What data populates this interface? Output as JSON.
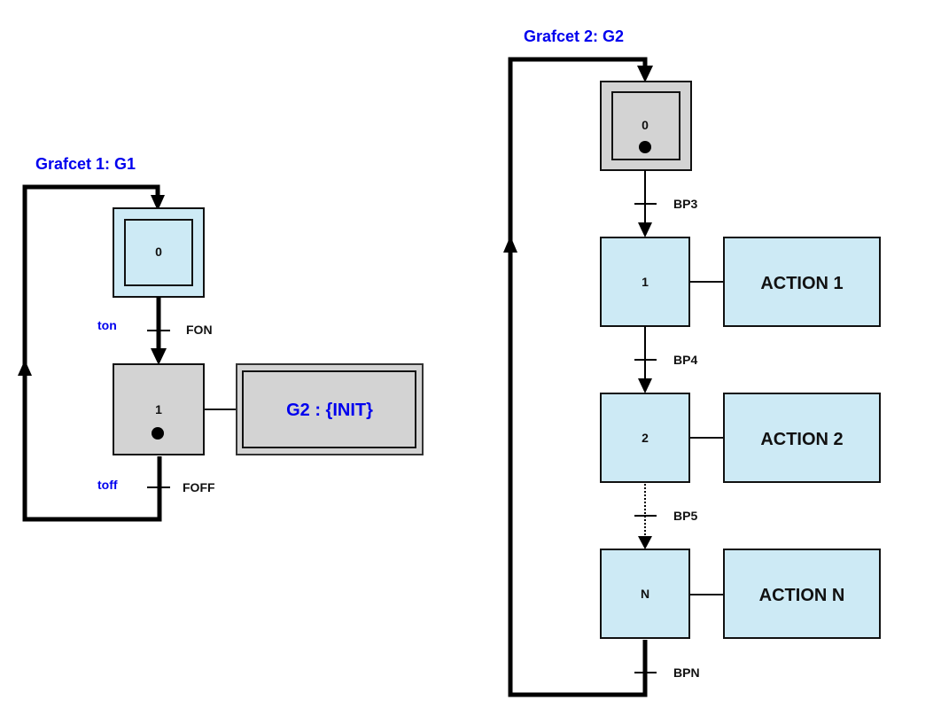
{
  "colors": {
    "active_step": "#d3d3d3",
    "inactive_step": "#cdeaf5",
    "title": "#0000ee",
    "line": "#000000"
  },
  "grafcet1": {
    "title": "Grafcet 1: G1",
    "steps": [
      {
        "id": "0",
        "initial": true,
        "active": false
      },
      {
        "id": "1",
        "initial": false,
        "active": true
      }
    ],
    "transitions": [
      {
        "label": "FON",
        "variable": "ton"
      },
      {
        "label": "FOFF",
        "variable": "toff"
      }
    ],
    "actions": [
      {
        "step": "1",
        "label": "G2 : {INIT}",
        "type": "macro"
      }
    ]
  },
  "grafcet2": {
    "title": "Grafcet 2: G2",
    "steps": [
      {
        "id": "0",
        "initial": true,
        "active": true
      },
      {
        "id": "1",
        "initial": false,
        "active": false
      },
      {
        "id": "2",
        "initial": false,
        "active": false
      },
      {
        "id": "N",
        "initial": false,
        "active": false
      }
    ],
    "transitions": [
      {
        "label": "BP3"
      },
      {
        "label": "BP4"
      },
      {
        "label": "BP5",
        "dotted": true
      },
      {
        "label": "BPN"
      }
    ],
    "actions": [
      {
        "step": "1",
        "label": "ACTION 1"
      },
      {
        "step": "2",
        "label": "ACTION 2"
      },
      {
        "step": "N",
        "label": "ACTION N"
      }
    ]
  }
}
